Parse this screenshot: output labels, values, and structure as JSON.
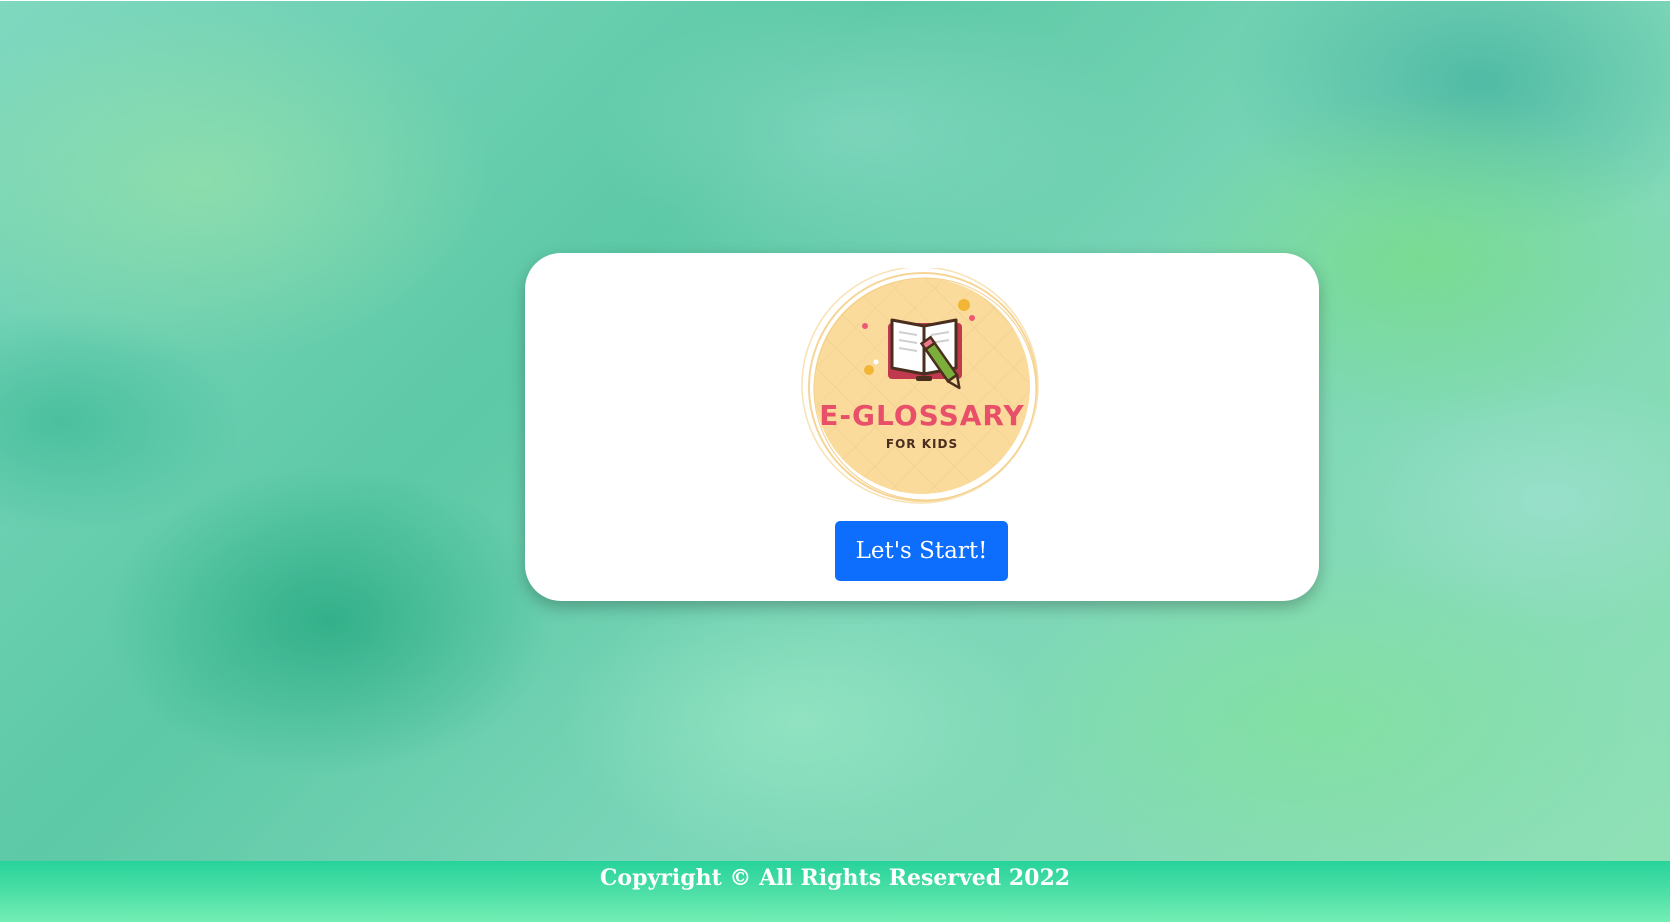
{
  "logo": {
    "title": "E-GLOSSARY",
    "subtitle": "FOR KIDS",
    "icon": "open-book-with-pencil-icon"
  },
  "actions": {
    "start_label": "Let's Start!"
  },
  "footer": {
    "copyright": "Copyright © All Rights Reserved 2022"
  },
  "colors": {
    "button": "#0d6efd",
    "footer": "#3fdca3",
    "logo_circle": "#fbdb9b",
    "logo_title": "#e8506a"
  }
}
